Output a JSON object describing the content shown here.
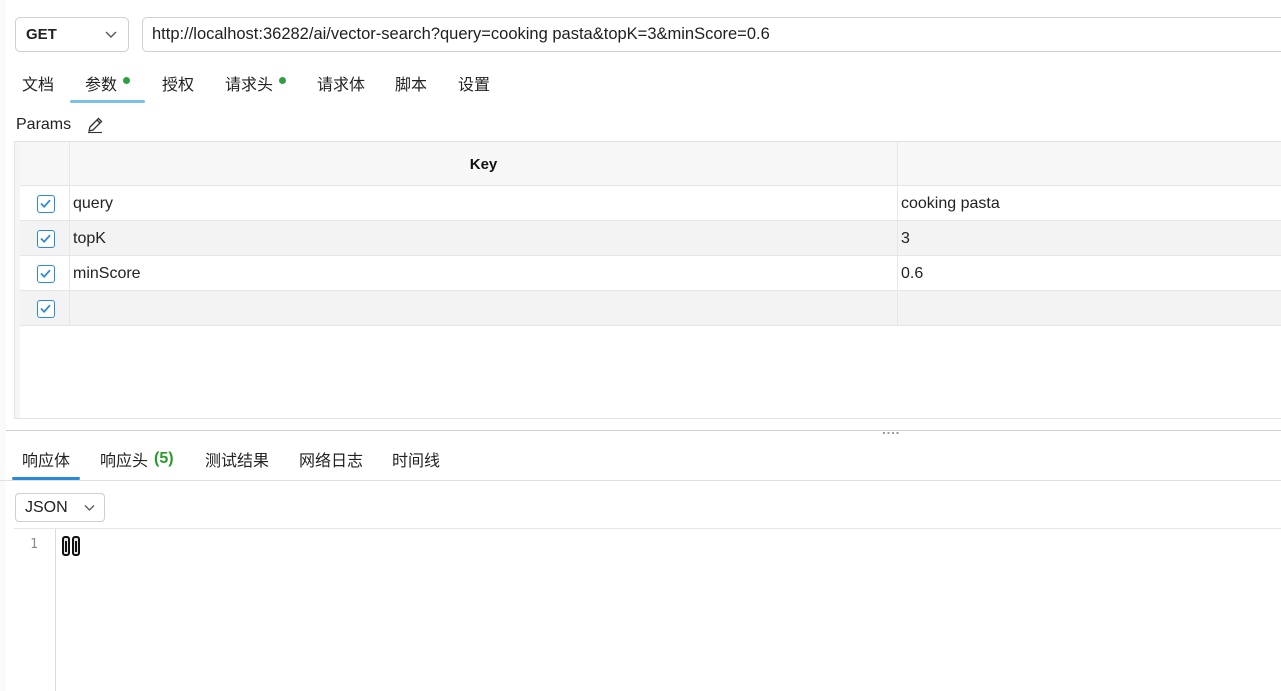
{
  "request": {
    "method": "GET",
    "url": "http://localhost:36282/ai/vector-search?query=cooking pasta&topK=3&minScore=0.6"
  },
  "request_tabs": [
    {
      "label": "文档",
      "dot": false
    },
    {
      "label": "参数",
      "dot": true,
      "active": true
    },
    {
      "label": "授权",
      "dot": false
    },
    {
      "label": "请求头",
      "dot": true
    },
    {
      "label": "请求体",
      "dot": false
    },
    {
      "label": "脚本",
      "dot": false
    },
    {
      "label": "设置",
      "dot": false
    }
  ],
  "params": {
    "title": "Params",
    "columns": {
      "key": "Key"
    },
    "rows": [
      {
        "key": "query",
        "value": "cooking pasta",
        "checked": true
      },
      {
        "key": "topK",
        "value": "3",
        "checked": true
      },
      {
        "key": "minScore",
        "value": "0.6",
        "checked": true
      },
      {
        "key": "",
        "value": "",
        "checked": true
      }
    ]
  },
  "response_tabs": [
    {
      "label": "响应体",
      "active": true
    },
    {
      "label": "响应头",
      "count": "(5)"
    },
    {
      "label": "测试结果"
    },
    {
      "label": "网络日志"
    },
    {
      "label": "时间线"
    }
  ],
  "response": {
    "format": "JSON",
    "line_number": "1",
    "body": "[]"
  },
  "colors": {
    "accent": "#2b8ad8",
    "active_tab_underline": "#7cc0ea",
    "dot_green": "#2ea043",
    "count_green": "#2a9a2a"
  }
}
